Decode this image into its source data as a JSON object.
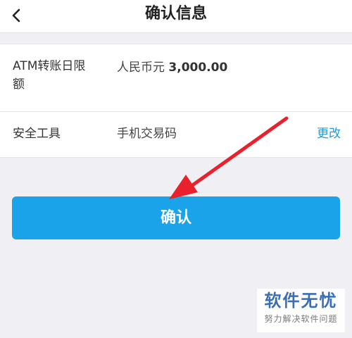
{
  "header": {
    "title": "确认信息",
    "back_icon": "chevron-left-icon"
  },
  "details": {
    "atm_limit_label": "ATM转账日限额",
    "atm_limit_currency": "人民币元",
    "atm_limit_amount": "3,000.00",
    "security_tool_label": "安全工具",
    "security_tool_value": "手机交易码",
    "change_link": "更改"
  },
  "actions": {
    "confirm_label": "确认"
  },
  "watermark": {
    "brand": "软件无忧",
    "tagline": "努力解决软件问题"
  },
  "colors": {
    "accent": "#1ba3e9",
    "link": "#1e9be2",
    "arrow": "#e8212d",
    "watermark_brand": "#3a6fb8"
  }
}
